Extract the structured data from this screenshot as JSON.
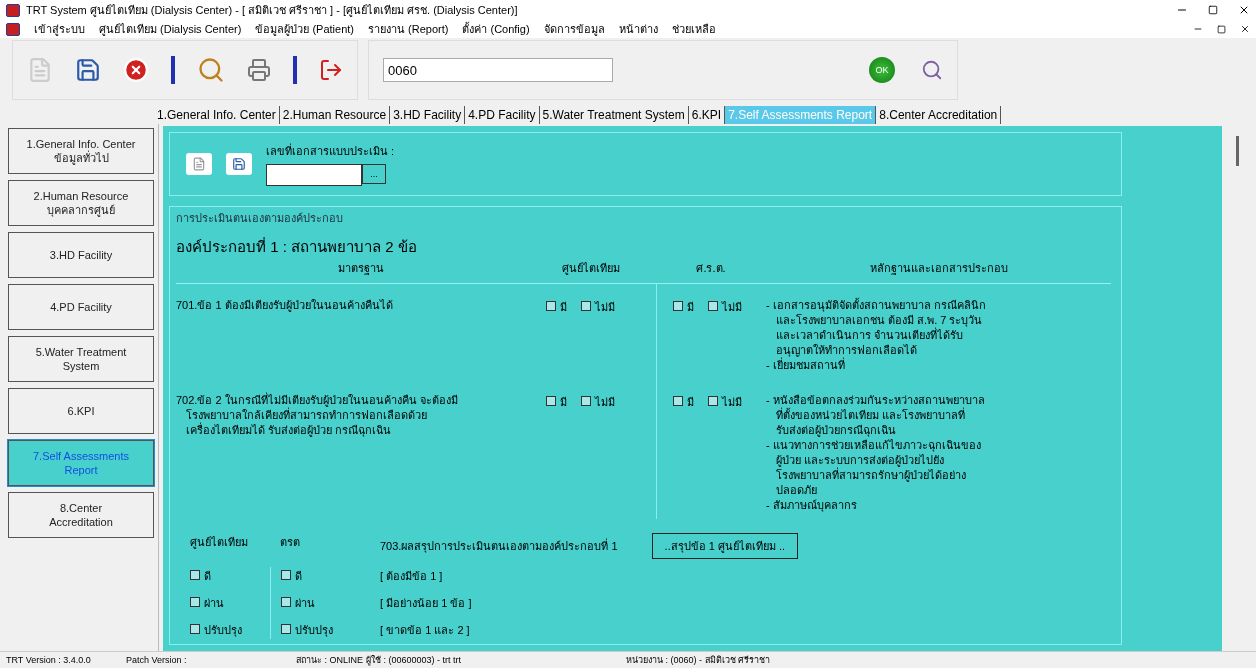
{
  "window": {
    "title": "TRT System ศูนย์ไตเทียม (Dialysis Center) - [ สมิติเวช ศรีราชา ] - [ศูนย์ไตเทียม ศรช. (Dialysis Center)]"
  },
  "menu": [
    "เข้าสู่ระบบ",
    "ศูนย์ไตเทียม (Dialysis Center)",
    "ข้อมูลผู้ป่วย (Patient)",
    "รายงาน (Report)",
    "ตั้งค่า (Config)",
    "จัดการข้อมูล",
    "หน้าต่าง",
    "ช่วยเหลือ"
  ],
  "toolbar": {
    "code_value": "0060",
    "ok_label": "OK"
  },
  "tabs": [
    {
      "label": "1.General Info. Center",
      "selected": false
    },
    {
      "label": "2.Human Resource",
      "selected": false
    },
    {
      "label": "3.HD Facility",
      "selected": false
    },
    {
      "label": "4.PD Facility",
      "selected": false
    },
    {
      "label": "5.Water Treatment System",
      "selected": false
    },
    {
      "label": "6.KPI",
      "selected": false
    },
    {
      "label": "7.Self Assessments Report",
      "selected": true
    },
    {
      "label": "8.Center Accreditation",
      "selected": false
    }
  ],
  "sidebar": {
    "items": [
      {
        "lines": [
          "1.General Info. Center",
          "ข้อมูลทั่วไป"
        ],
        "selected": false
      },
      {
        "lines": [
          "2.Human Resource",
          "บุคคลากรศูนย์"
        ],
        "selected": false
      },
      {
        "lines": [
          "3.HD Facility"
        ],
        "selected": false
      },
      {
        "lines": [
          "4.PD Facility"
        ],
        "selected": false
      },
      {
        "lines": [
          "5.Water Treatment",
          "System"
        ],
        "selected": false
      },
      {
        "lines": [
          "6.KPI"
        ],
        "selected": false
      },
      {
        "lines": [
          "7.Self Assessments",
          "Report"
        ],
        "selected": true
      },
      {
        "lines": [
          "8.Center",
          "Accreditation"
        ],
        "selected": false
      }
    ]
  },
  "document": {
    "label": "เลขที่เอกสารแบบประเมิน :",
    "browse_label": "..."
  },
  "assessment": {
    "group_title": "การประเมินตนเองตามองค์ประกอบ",
    "heading": "องค์ประกอบที่ 1 : สถานพยาบาล 2 ข้อ",
    "columns": [
      "มาตรฐาน",
      "ศูนย์ไตเทียม",
      "ศ.ร.ต.",
      "หลักฐานและเอกสารประกอบ"
    ],
    "rows": [
      {
        "standard": [
          "701.ข้อ 1 ต้องมีเตียงรับผู้ป่วยในนอนค้างคืนได้"
        ],
        "center": [
          {
            "label": "มี",
            "checked": false
          },
          {
            "label": "ไม่มี",
            "checked": false
          }
        ],
        "trt": [
          {
            "label": "มี",
            "checked": false
          },
          {
            "label": "ไม่มี",
            "checked": false
          }
        ],
        "evidence": [
          [
            "- เอกสารอนุมัติจัดตั้งสถานพยาบาล กรณีคลินิก",
            "และโรงพยาบาลเอกชน ต้องมี ส.พ. 7 ระบุวัน",
            "และเวลาดำเนินการ จำนวนเตียงที่ได้รับ",
            "อนุญาตให้ทำการฟอกเลือดได้"
          ],
          [
            "- เยี่ยมชมสถานที่"
          ]
        ]
      },
      {
        "standard": [
          "702.ข้อ 2 ในกรณีที่ไม่มีเตียงรับผู้ป่วยในนอนค้างคืน  จะต้องมี",
          "โรงพยาบาลใกล้เคียงที่สามารถทำการฟอกเลือดด้วย",
          "เครื่องไตเทียมได้ รับส่งต่อผู้ป่วย กรณีฉุกเฉิน"
        ],
        "center": [
          {
            "label": "มี",
            "checked": false
          },
          {
            "label": "ไม่มี",
            "checked": false
          }
        ],
        "trt": [
          {
            "label": "มี",
            "checked": false
          },
          {
            "label": "ไม่มี",
            "checked": false
          }
        ],
        "evidence": [
          [
            "- หนังสือข้อตกลงร่วมกันระหว่างสถานพยาบาล",
            "ที่ตั้งของหน่วยไตเทียม และโรงพยาบาลที่",
            "รับส่งต่อผู้ป่วยกรณีฉุกเฉิน"
          ],
          [
            "- แนวทางการช่วยเหลือแก้ไขภาวะฉุกเฉินของ",
            "ผู้ป่วย และระบบการส่งต่อผู้ป่วยไปยัง",
            "โรงพยาบาลที่สามารถรักษาผู้ป่วยได้อย่าง",
            "ปลอดภัย"
          ],
          [
            "- สัมภาษณ์บุคลากร"
          ]
        ]
      }
    ],
    "summary": {
      "center_header": "ศูนย์ไตเทียม",
      "trt_header": "ตรต",
      "title": "703.ผลสรุปการประเมินตนเองตามองค์ประกอบที่ 1",
      "button": "..สรุปข้อ 1 ศูนย์ไตเทียม ..",
      "center": [
        {
          "label": "ดี",
          "checked": false
        },
        {
          "label": "ผ่าน",
          "checked": false
        },
        {
          "label": "ปรับปรุง",
          "checked": false
        }
      ],
      "trt": [
        {
          "label": "ดี",
          "checked": false
        },
        {
          "label": "ผ่าน",
          "checked": false
        },
        {
          "label": "ปรับปรุง",
          "checked": false
        }
      ],
      "criteria": [
        "[ ต้องมีข้อ 1 ]",
        "[ มีอย่างน้อย 1 ข้อ ]",
        "[ ขาดข้อ 1 และ 2 ]"
      ]
    }
  },
  "status_bar": [
    "TRT Version : 3.4.0.0",
    "Patch Version :",
    "สถานะ : ONLINE",
    "ผู้ใช้ : (00600003) - trt trt",
    "หน่วยงาน : (0060) - สมิติเวช ศรีราชา"
  ]
}
